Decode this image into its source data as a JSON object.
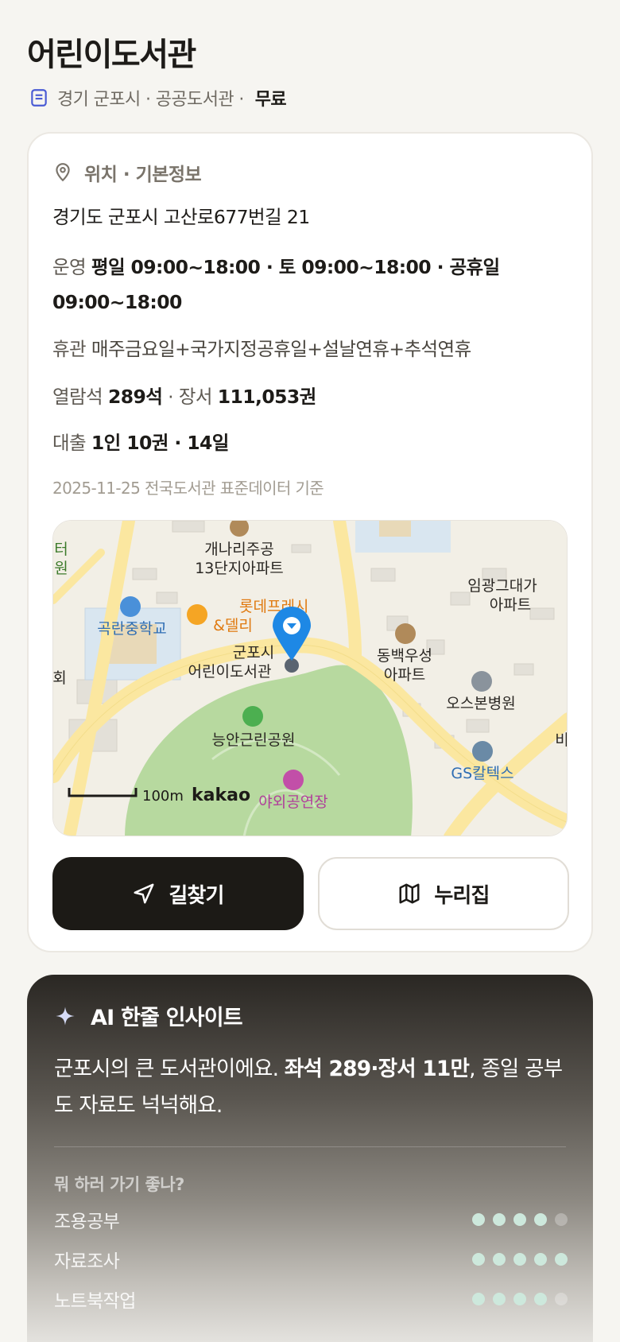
{
  "header": {
    "title": "어린이도서관",
    "meta": "경기 군포시 · 공공도서관 ·",
    "fee": "무료",
    "meta_icon": "document-icon"
  },
  "info": {
    "section_title": "위치 · 기본정보",
    "section_icon": "map-pin-icon",
    "address": "경기도 군포시 고산로677번길 21",
    "hours_label": "운영",
    "hours_value": "평일 09:00~18:00 · 토 09:00~18:00 · 공휴일 09:00~18:00",
    "closed_label": "휴관",
    "closed_value": "매주금요일+국가지정공휴일+설날연휴+추석연휴",
    "seats_label": "열람석",
    "seats_value": "289석",
    "books_sep": "· 장서",
    "books_value": "111,053권",
    "loan_label": "대출",
    "loan_value": "1인 10권 · 14일",
    "as_of": "2025-11-25 전국도서관 표준데이터 기준"
  },
  "map": {
    "labels": {
      "complex13": "개나리주공\n13단지아파트",
      "school": "곡란중학교",
      "lotte": "롯데프레시\n&델리",
      "library": "군포시\n어린이도서관",
      "dongbaek": "동백우성\n아파트",
      "imgwang": "임광그대가\n아파트",
      "hospital": "오스본병원",
      "park": "능안근린공원",
      "gs": "GS칼텍스",
      "outdoor": "야외공연장",
      "edge_left1": "터\n원",
      "edge_left2": "회",
      "edge_right": "비"
    },
    "scale": "100m",
    "brand": "kakao",
    "colors": {
      "land": "#f2efe6",
      "road": "#fbe7a0",
      "park": "#b7d99f",
      "pin": "#1e88e5"
    }
  },
  "actions": {
    "directions_label": "길찾기",
    "directions_icon": "navigation-arrow-icon",
    "nuri_label": "누리집",
    "nuri_icon": "map-fold-icon"
  },
  "ai": {
    "title": "AI 한줄 인사이트",
    "icon": "sparkle-icon",
    "text_pre": "군포시의 큰 도서관이에요. ",
    "text_bold": "좌석 289·장서 11만",
    "text_post": ", 종일 공부도 자료도 넉넉해요.",
    "question": "뭐 하러 가기 좋나?",
    "scores": [
      {
        "name": "조용공부",
        "value": 4
      },
      {
        "name": "자료조사",
        "value": 5
      },
      {
        "name": "노트북작업",
        "value": 4
      }
    ],
    "max_score": 5
  }
}
